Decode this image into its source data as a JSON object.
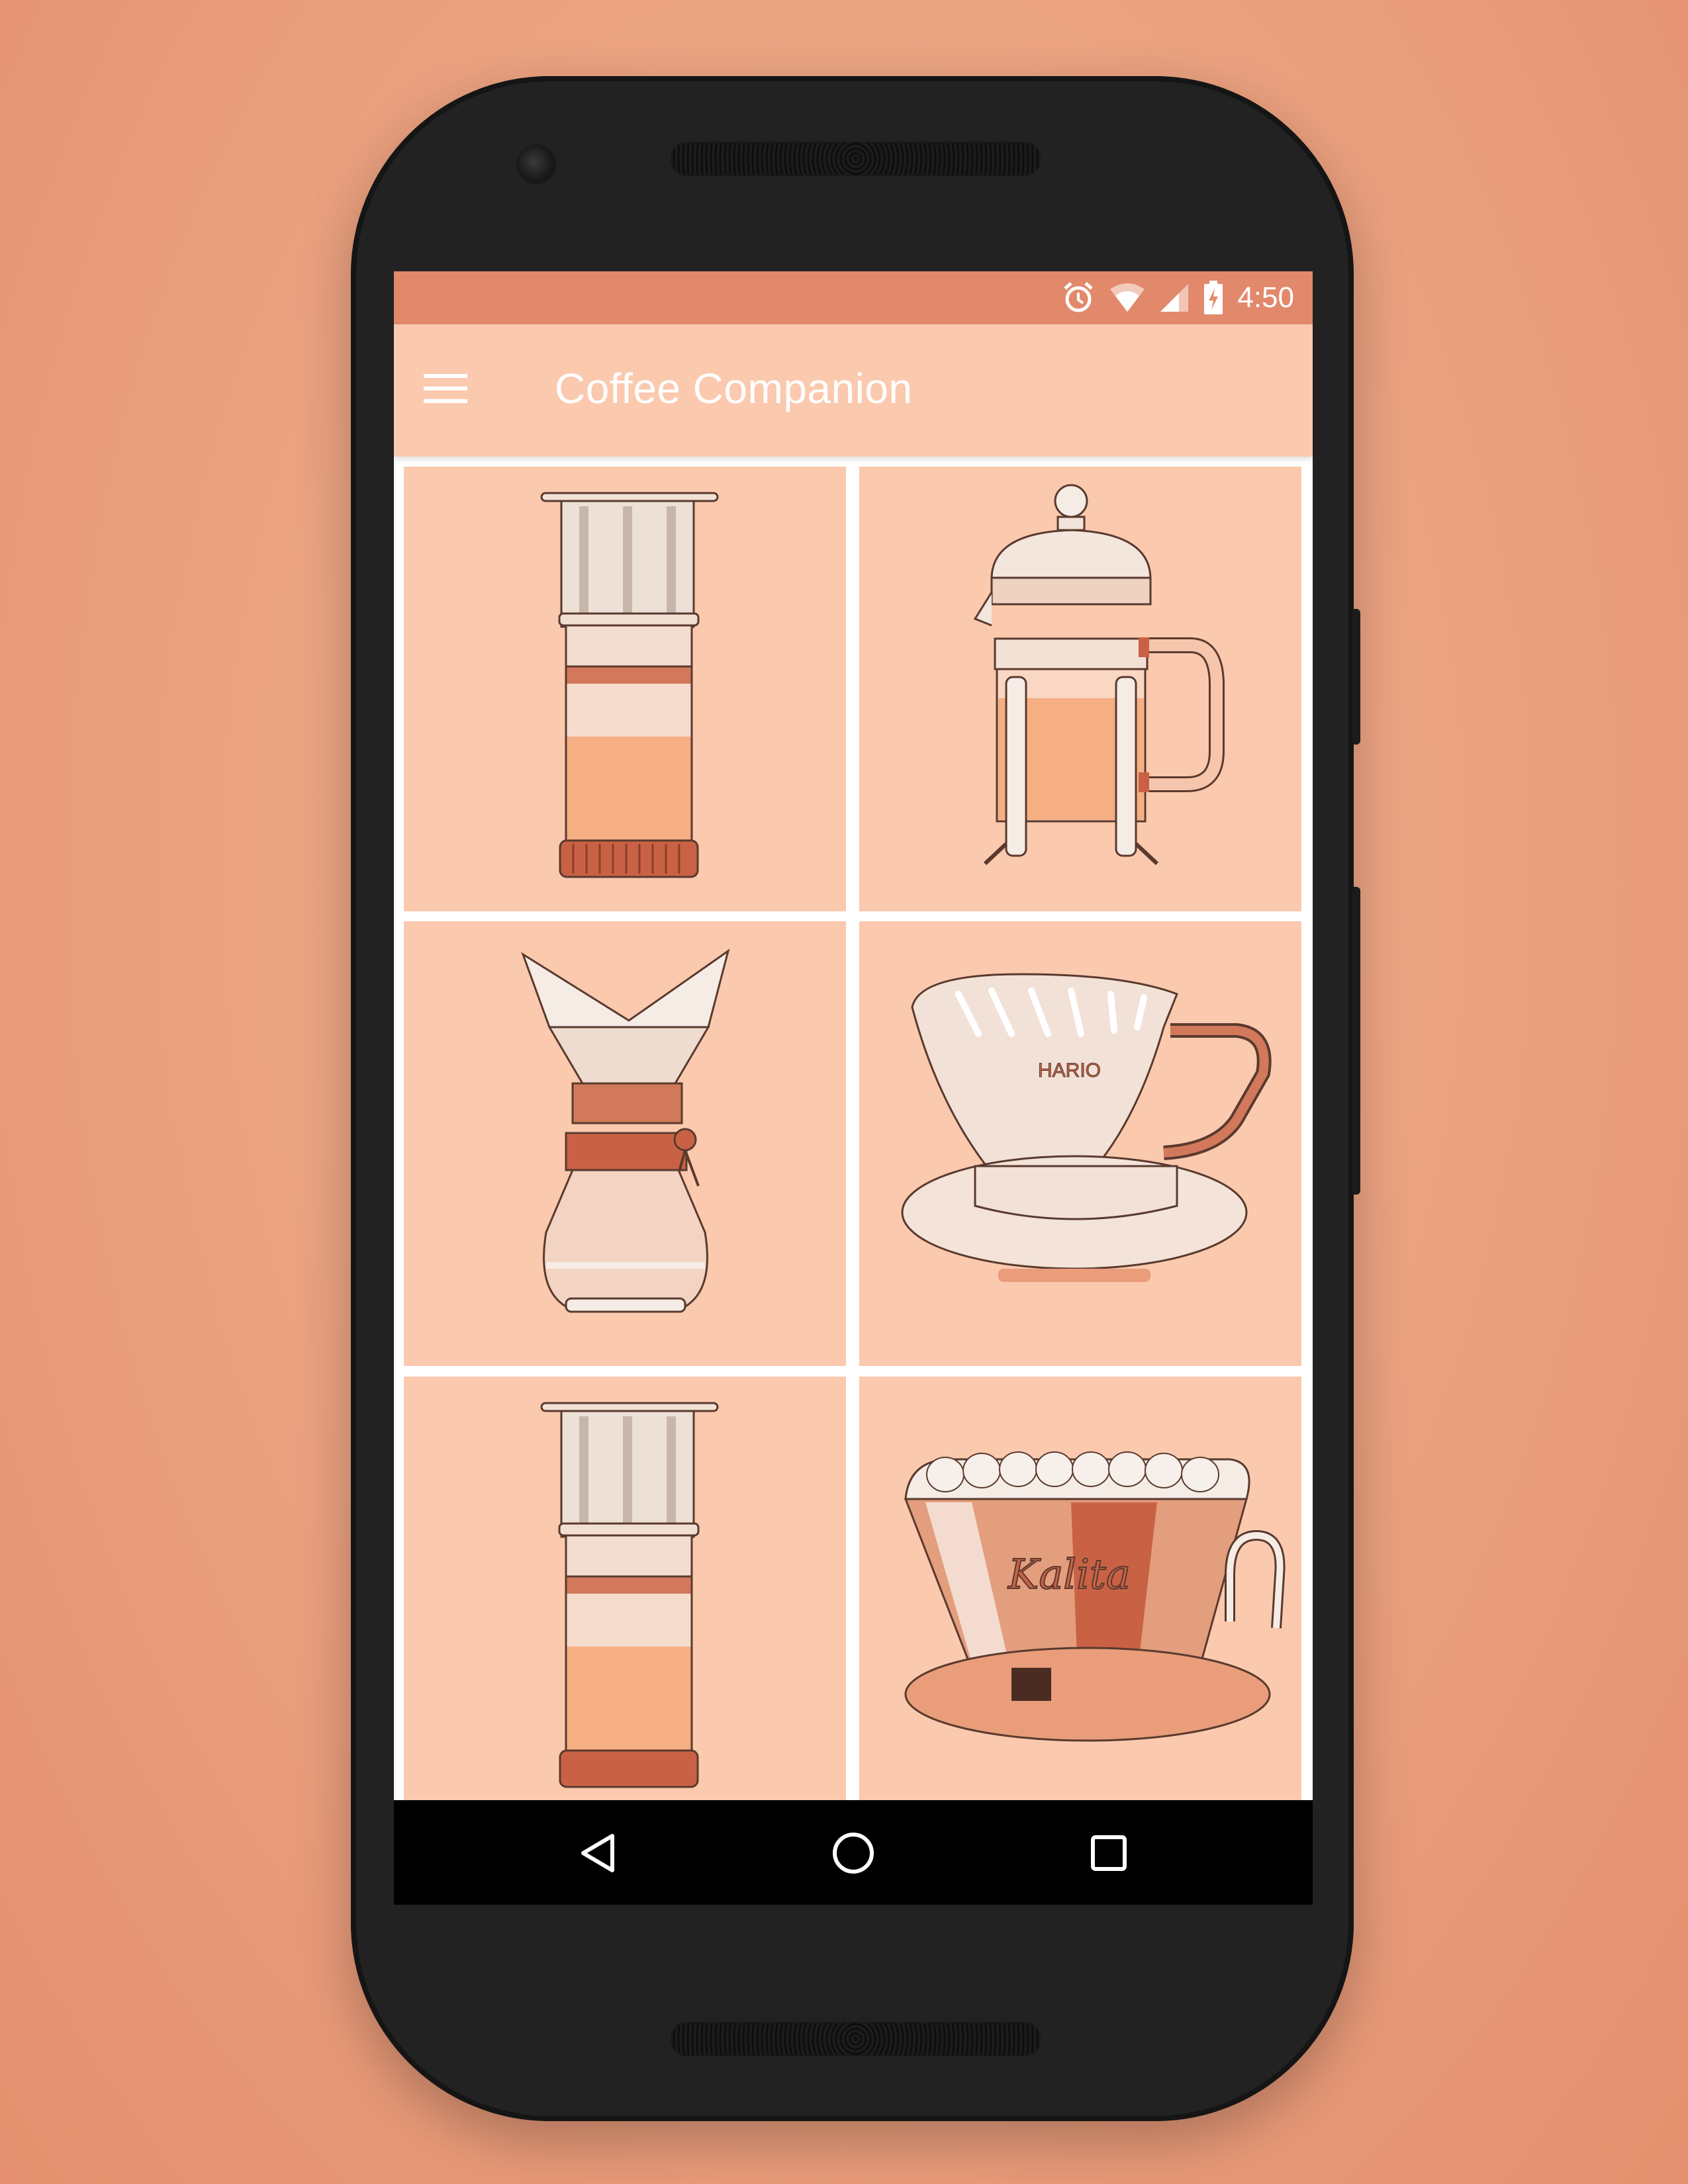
{
  "status_bar": {
    "time": "4:50",
    "icons": [
      "alarm-icon",
      "wifi-icon",
      "cell-signal-icon",
      "battery-charging-icon"
    ]
  },
  "app_bar": {
    "title": "Coffee Companion",
    "menu_icon": "hamburger-menu-icon"
  },
  "tiles": [
    {
      "name": "aeropress",
      "icon": "aeropress-illustration"
    },
    {
      "name": "french-press",
      "icon": "french-press-illustration"
    },
    {
      "name": "chemex",
      "icon": "chemex-illustration"
    },
    {
      "name": "hario-v60",
      "icon": "hario-v60-illustration",
      "label": "HARIO"
    },
    {
      "name": "aeropress-2",
      "icon": "aeropress-illustration"
    },
    {
      "name": "kalita",
      "icon": "kalita-wave-illustration",
      "label": "Kalita"
    }
  ],
  "nav_bar": {
    "back": "back-triangle-icon",
    "home": "home-circle-icon",
    "recents": "recents-square-icon"
  },
  "colors": {
    "background": "#eba482",
    "status_bar": "#e2896c",
    "app_bar": "#fbc9ae",
    "tile": "#fbc9ae",
    "accent_brown": "#c86d4f",
    "liquid": "#f6ae83"
  }
}
